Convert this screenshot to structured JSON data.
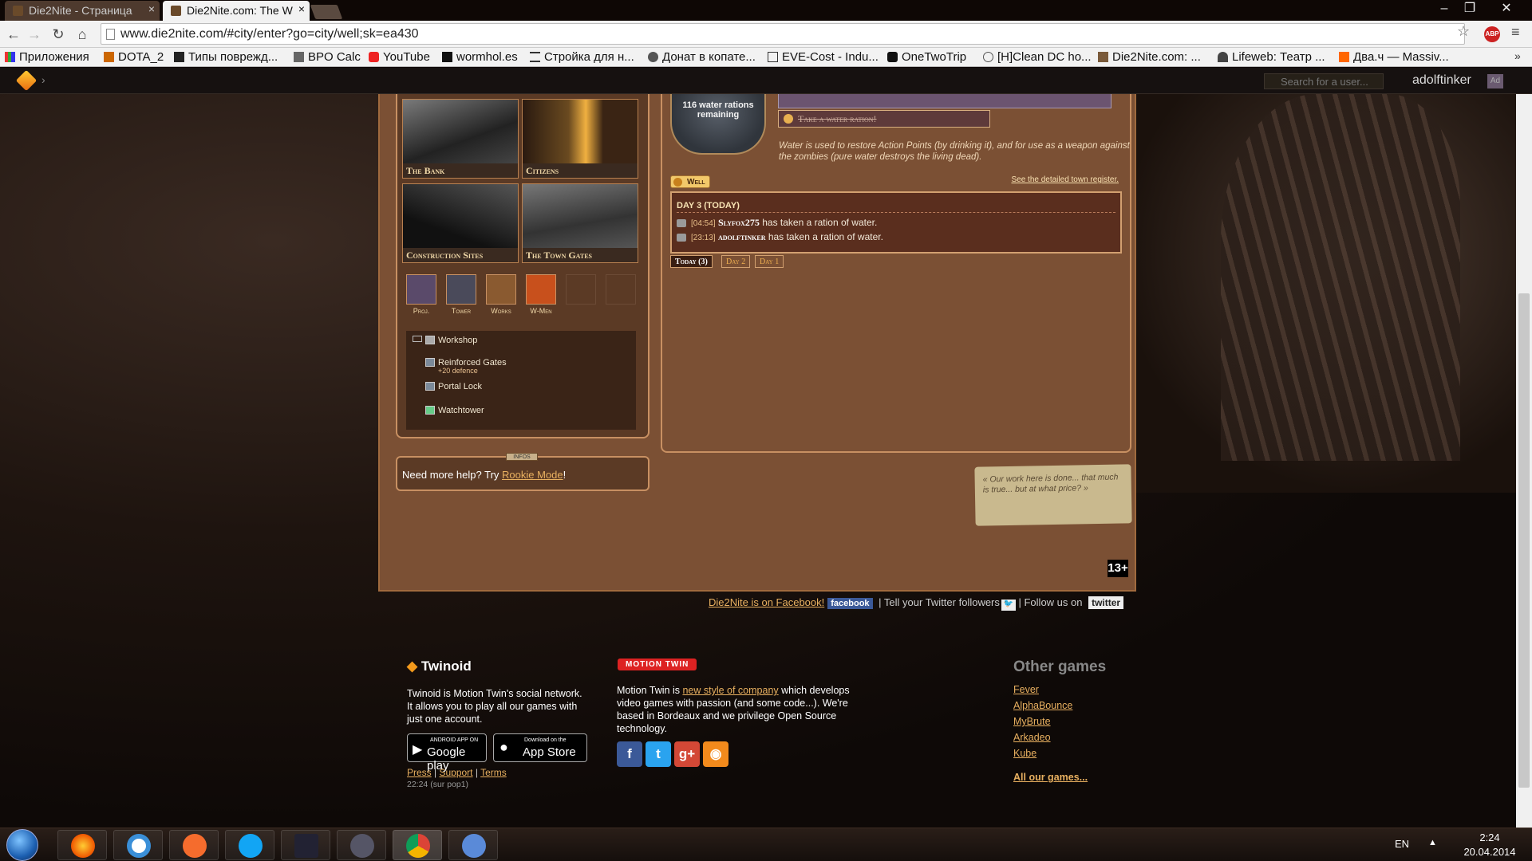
{
  "browser": {
    "tabs": [
      {
        "title": "Die2Nite - Страница",
        "active": false
      },
      {
        "title": "Die2Nite.com: The W",
        "active": true
      }
    ],
    "url": "www.die2nite.com/#city/enter?go=city/well;sk=ea430",
    "bookmarks": [
      "Приложения",
      "DOTA_2",
      "Типы поврежд...",
      "BPO Calc",
      "YouTube",
      "wormhol.es",
      "Стройка для н...",
      "Донат в копате...",
      "EVE-Cost - Indu...",
      "OneTwoTrip",
      "[H]Clean DC ho...",
      "Die2Nite.com: ...",
      "Lifeweb: Театр ...",
      "Два.ч — Massiv..."
    ],
    "bookmarks_more": "»"
  },
  "twinoid_bar": {
    "search_placeholder": "Search for a user...",
    "username": "adolftinker",
    "avatar_text": "Ad"
  },
  "city": {
    "places": [
      {
        "label": "The Bank"
      },
      {
        "label": "Citizens"
      },
      {
        "label": "Construction Sites"
      },
      {
        "label": "The Town Gates"
      }
    ],
    "building_icons": [
      "Proj.",
      "Tower",
      "Works",
      "W-Men"
    ],
    "workshop": {
      "title": "Workshop",
      "items": [
        {
          "name": "Reinforced Gates",
          "detail": "+20 defence"
        },
        {
          "name": "Portal Lock",
          "detail": ""
        },
        {
          "name": "Watchtower",
          "detail": ""
        }
      ]
    },
    "help": {
      "text": "Need more help? Try ",
      "link": "Rookie Mode",
      "suffix": "!",
      "tag": "INFOS"
    }
  },
  "well": {
    "rations_text": "116 water rations remaining",
    "take_button": "Take a water ration!",
    "description": "Water is used to restore Action Points (by drinking it), and for use as a weapon against the zombies (pure water destroys the living dead).",
    "section_label": "Well",
    "register_link": "See the detailed town register.",
    "log_day": "DAY 3 (TODAY)",
    "log": [
      {
        "time": "[04:54]",
        "name": "Slyfox275",
        "action": " has taken a ration of water."
      },
      {
        "time": "[23:13]",
        "name": "adolftinker",
        "action": " has taken a ration of water."
      }
    ],
    "day_tabs": [
      "Today (3)",
      "Day 2",
      "Day 1"
    ]
  },
  "quote": "« Our work here is done... that much is true... but at what price? »",
  "age_rating": "13+",
  "social": {
    "facebook_text": "Die2Nite is on Facebook!",
    "facebook_badge": "facebook",
    "twitter_text": " | Tell your Twitter followers",
    "follow_text": " | Follow us on ",
    "twitter_badge": "twitter"
  },
  "footer": {
    "twinoid_logo": "Twinoid",
    "twinoid_desc": "Twinoid is Motion Twin's social network. It allows you to play all our games with just one account.",
    "google_play_top": "ANDROID APP ON",
    "google_play": "Google play",
    "app_store_top": "Download on the",
    "app_store": "App Store",
    "links": [
      "Press",
      "Support",
      "Terms"
    ],
    "server": "22:24 (sur pop1)",
    "mt_logo": "MOTION TWIN",
    "mt_desc_pre": "Motion Twin is ",
    "mt_desc_link": "new style of company",
    "mt_desc_post": " which develops video games with passion (and some code...). We're based in Bordeaux and we privilege Open Source technology.",
    "other_games_title": "Other games",
    "other_games": [
      "Fever",
      "AlphaBounce",
      "MyBrute",
      "Arkadeo",
      "Kube"
    ],
    "all_games": "All our games..."
  },
  "taskbar": {
    "lang": "EN",
    "time": "2:24",
    "date": "20.04.2014"
  }
}
